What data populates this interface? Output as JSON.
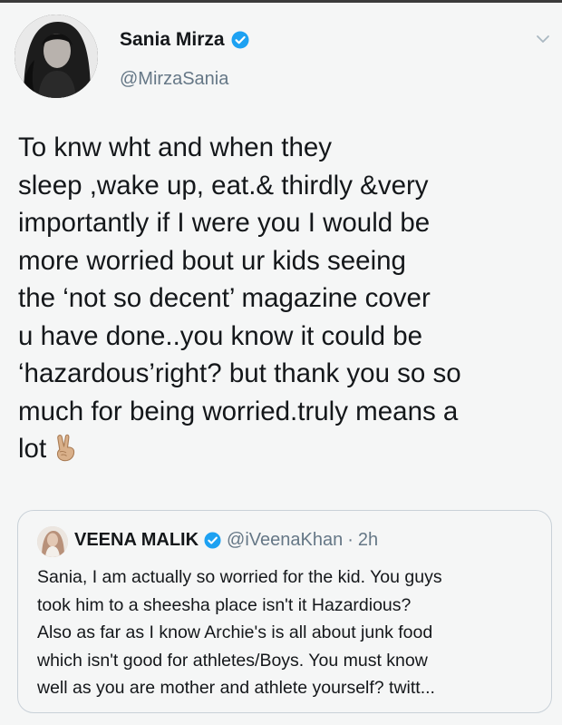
{
  "author": {
    "display_name": "Sania Mirza",
    "handle": "@MirzaSania",
    "verified": true
  },
  "tweet": {
    "lines": [
      "To knw wht and when they",
      "sleep ,wake up, eat.& thirdly &very",
      "importantly if I were you I would be",
      "more worried bout ur kids seeing",
      "the ‘not so decent’ magazine cover",
      "u have done..you know it could be",
      "‘hazardous’right? but thank you so so",
      "much for being worried.truly means a",
      "lot"
    ],
    "emoji": "victory-hand-emoji"
  },
  "quoted_tweet": {
    "display_name": "VEENA MALIK",
    "verified": true,
    "handle": "@iVeenaKhan",
    "separator": "·",
    "time": "2h",
    "lines": [
      "Sania, I am actually so worried for the kid. You guys",
      "took him to a sheesha place isn't it Hazardious?",
      "Also as far as I know Archie's is all about junk food",
      "which isn't good for athletes/Boys. You must know",
      "well as you are mother and athlete yourself? twitt..."
    ]
  },
  "colors": {
    "text": "#14171a",
    "secondary": "#657786",
    "verified_blue": "#1da1f2",
    "quote_border": "#c9d1d8",
    "background": "#f5f6f6"
  }
}
